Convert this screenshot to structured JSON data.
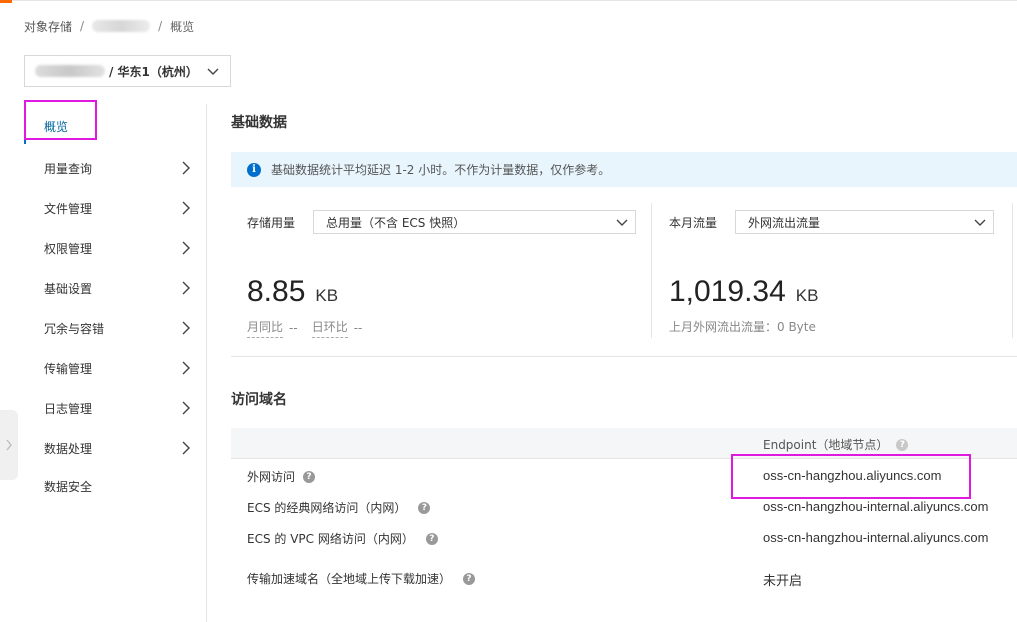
{
  "breadcrumb": {
    "root": "对象存储",
    "current": "概览"
  },
  "bucket_selector": {
    "region": "/ 华东1（杭州）"
  },
  "sidebar": {
    "items": [
      {
        "label": "概览"
      },
      {
        "label": "用量查询"
      },
      {
        "label": "文件管理"
      },
      {
        "label": "权限管理"
      },
      {
        "label": "基础设置"
      },
      {
        "label": "冗余与容错"
      },
      {
        "label": "传输管理"
      },
      {
        "label": "日志管理"
      },
      {
        "label": "数据处理"
      },
      {
        "label": "数据安全"
      }
    ]
  },
  "basic_data": {
    "title": "基础数据",
    "notice": "基础数据统计平均延迟 1-2 小时。不作为计量数据，仅作参考。",
    "storage": {
      "label": "存储用量",
      "select_value": "总用量（不含 ECS 快照）",
      "value": "8.85",
      "unit": "KB",
      "mom_label": "月同比",
      "mom_value": "--",
      "dod_label": "日环比",
      "dod_value": "--"
    },
    "traffic": {
      "label": "本月流量",
      "select_value": "外网流出流量",
      "value": "1,019.34",
      "unit": "KB",
      "last_month": "上月外网流出流量：0 Byte"
    }
  },
  "domains": {
    "title": "访问域名",
    "column_header": "Endpoint（地域节点）",
    "rows": [
      {
        "label": "外网访问",
        "value": "oss-cn-hangzhou.aliyuncs.com"
      },
      {
        "label": "ECS 的经典网络访问（内网）",
        "value": "oss-cn-hangzhou-internal.aliyuncs.com"
      },
      {
        "label": "ECS 的 VPC 网络访问（内网）",
        "value": "oss-cn-hangzhou-internal.aliyuncs.com"
      },
      {
        "label": "传输加速域名（全地域上传下载加速）",
        "value": "未开启"
      }
    ]
  },
  "colors": {
    "accent": "#ff6a00",
    "link": "#0070cc",
    "highlight": "#e019e0",
    "notice_bg": "#e8f5fd"
  }
}
